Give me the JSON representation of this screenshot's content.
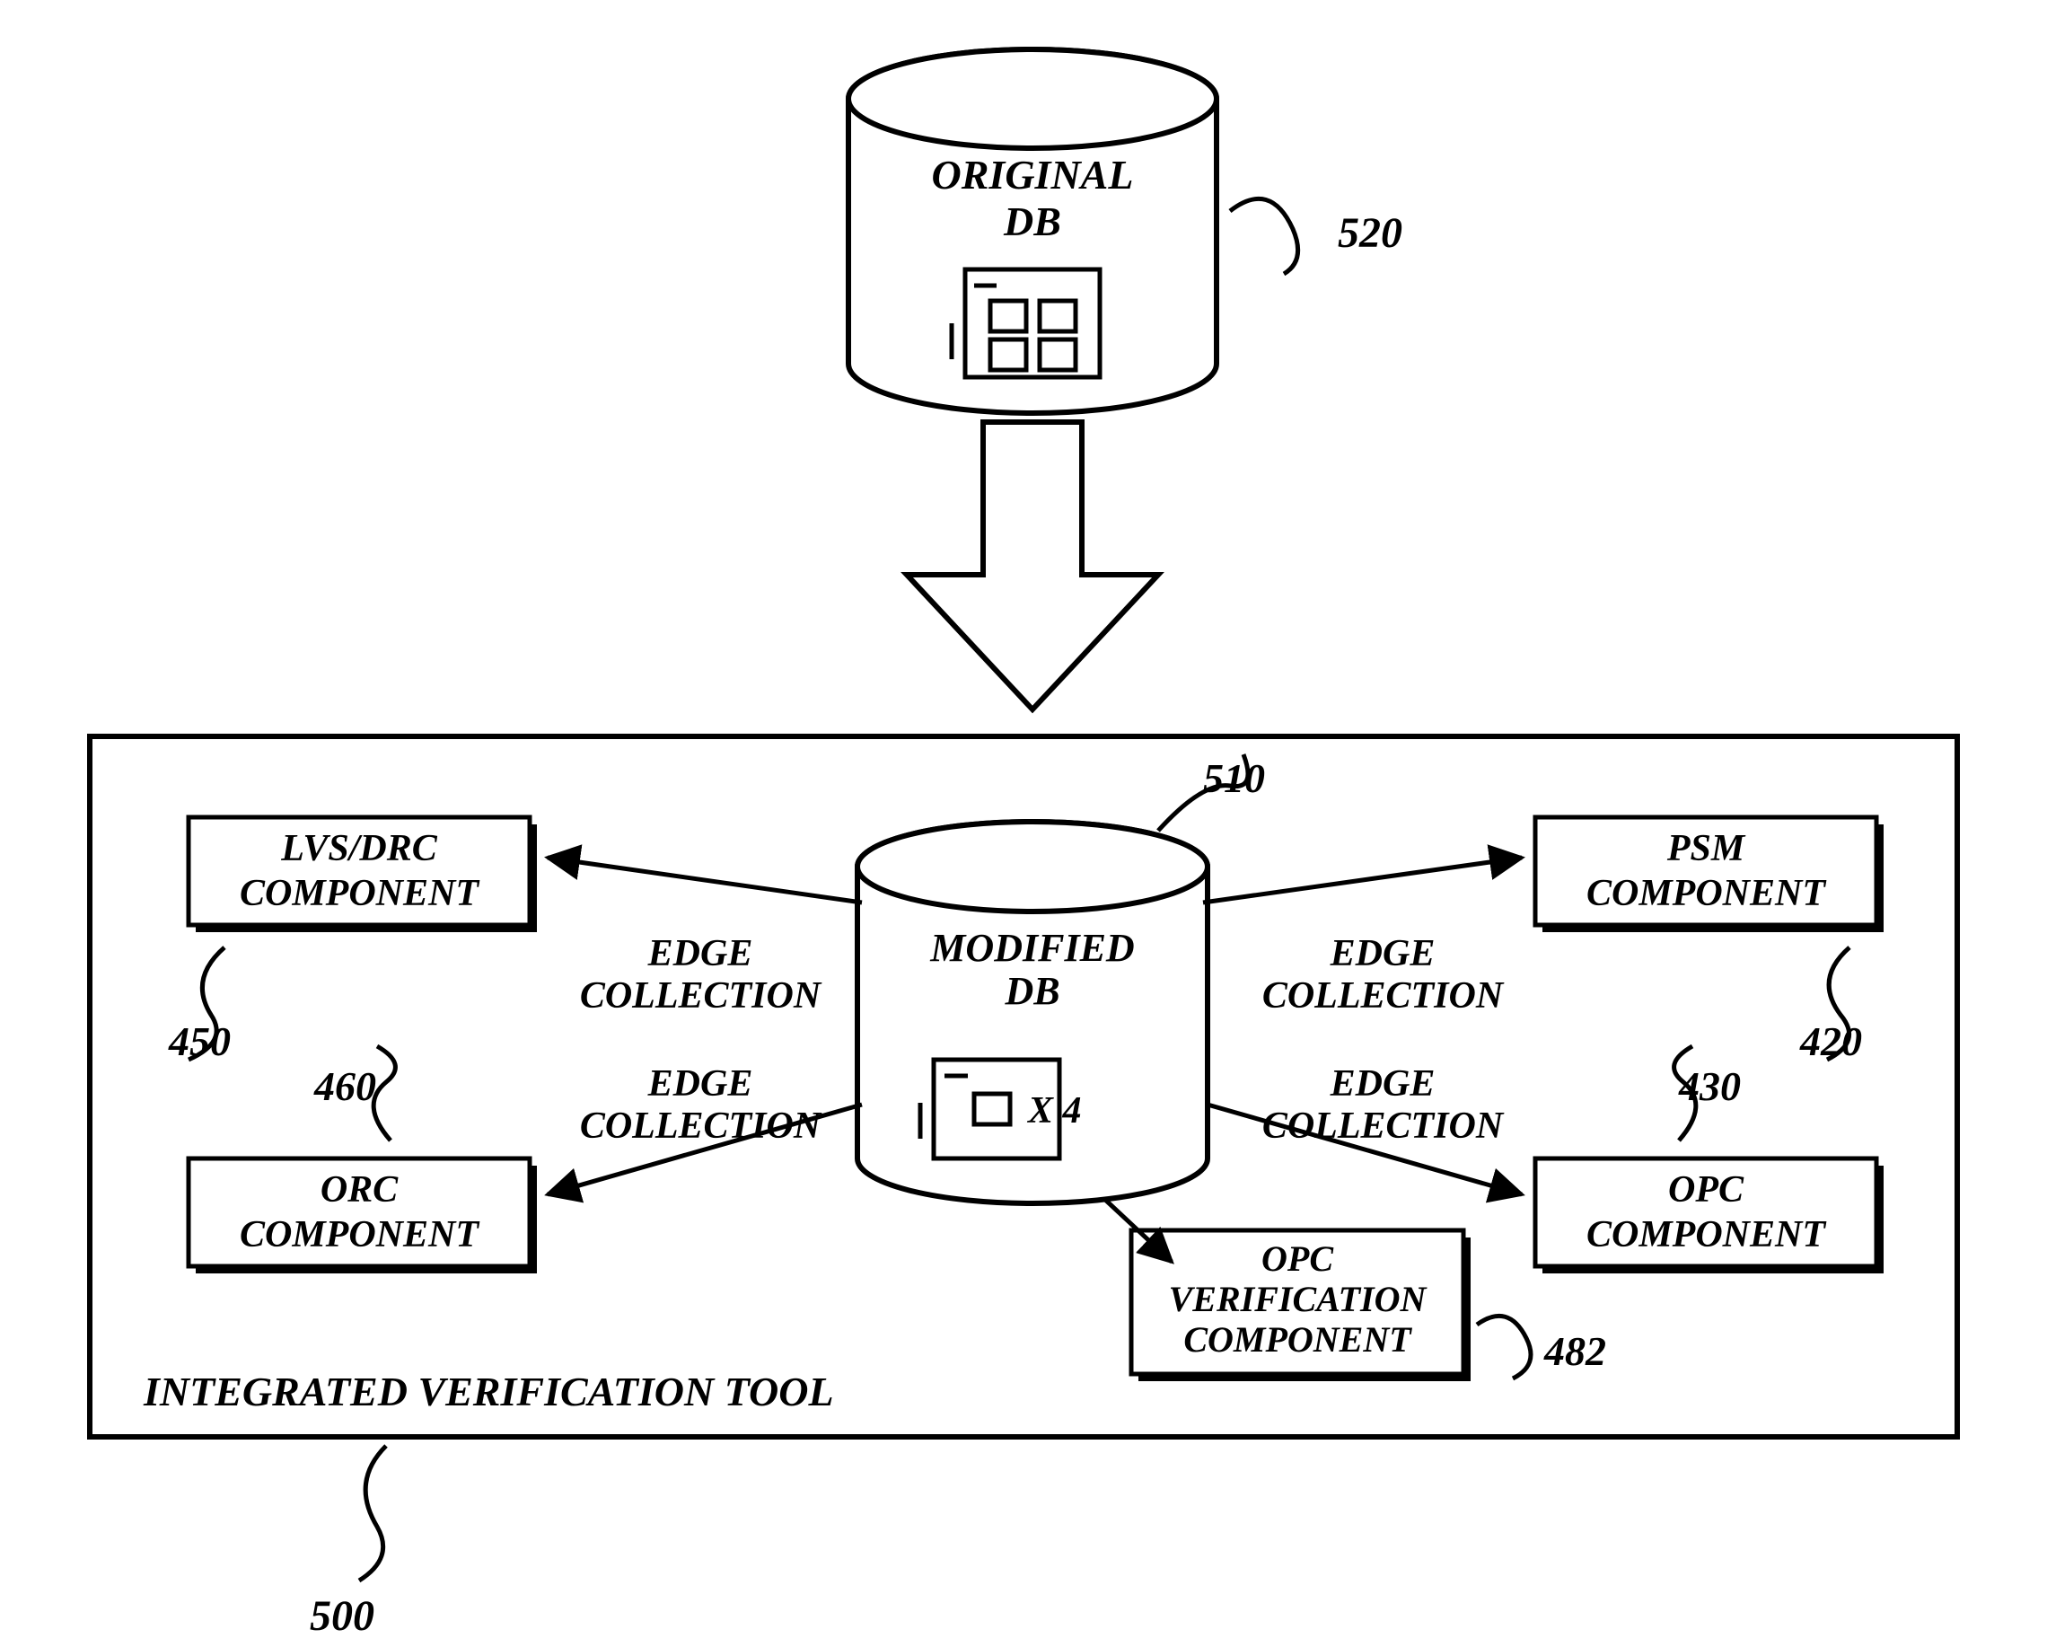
{
  "original_db": {
    "line1": "ORIGINAL",
    "line2": "DB",
    "ref": "520"
  },
  "modified_db": {
    "line1": "MODIFIED",
    "line2": "DB",
    "x4": "X 4",
    "ref": "510"
  },
  "components": {
    "lvs_drc": {
      "line1": "LVS/DRC",
      "line2": "COMPONENT",
      "ref": "450"
    },
    "psm": {
      "line1": "PSM",
      "line2": "COMPONENT",
      "ref": "420"
    },
    "orc": {
      "line1": "ORC",
      "line2": "COMPONENT",
      "ref": "460"
    },
    "opc": {
      "line1": "OPC",
      "line2": "COMPONENT",
      "ref": "430"
    },
    "opc_verif": {
      "line1": "OPC",
      "line2": "VERIFICATION",
      "line3": "COMPONENT",
      "ref": "482"
    }
  },
  "edge_labels": {
    "top_left": {
      "line1": "EDGE",
      "line2": "COLLECTION"
    },
    "top_right": {
      "line1": "EDGE",
      "line2": "COLLECTION"
    },
    "bot_left": {
      "line1": "EDGE",
      "line2": "COLLECTION"
    },
    "bot_right": {
      "line1": "EDGE",
      "line2": "COLLECTION"
    }
  },
  "tool": {
    "label": "INTEGRATED VERIFICATION TOOL",
    "ref": "500"
  }
}
